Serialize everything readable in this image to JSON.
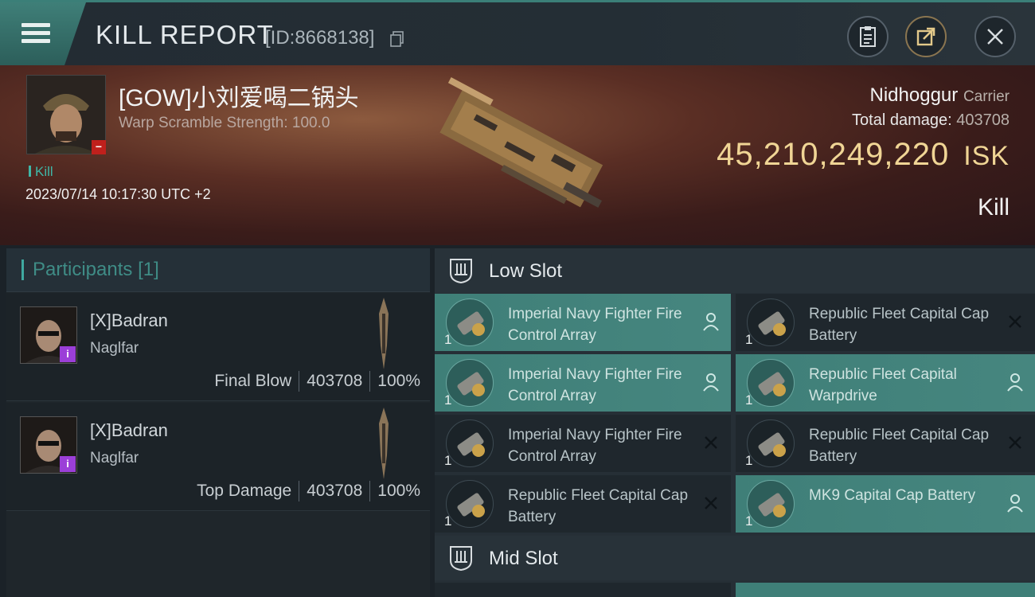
{
  "header": {
    "title": "KILL REPORT",
    "id_label": "[ID:8668138]",
    "icons": [
      "menu-icon",
      "copy-icon",
      "clipboard-icon",
      "share-icon",
      "close-icon"
    ]
  },
  "victim": {
    "pilot": "[GOW]小刘爱喝二锅头",
    "scramble": "Warp Scramble Strength: 100.0",
    "tag": "Kill",
    "datetime": "2023/07/14 10:17:30 UTC +2",
    "ship_name": "Nidhoggur",
    "ship_class": "Carrier",
    "total_damage_label": "Total damage:",
    "total_damage": "403708",
    "isk_value": "45,210,249,220",
    "isk_unit": "ISK",
    "result": "Kill"
  },
  "participants": {
    "label": "Participants",
    "count": "[1]",
    "cards": [
      {
        "name": "[X]Badran",
        "ship": "Naglfar",
        "role": "Final Blow",
        "damage": "403708",
        "percent": "100%"
      },
      {
        "name": "[X]Badran",
        "ship": "Naglfar",
        "role": "Top Damage",
        "damage": "403708",
        "percent": "100%"
      }
    ]
  },
  "slots": {
    "low_label": "Low Slot",
    "mid_label": "Mid Slot",
    "low_items": [
      {
        "qty": "1",
        "name": "Imperial Navy Fighter Fire Control Array",
        "state": "fitted",
        "mark": "person-icon"
      },
      {
        "qty": "1",
        "name": "Republic Fleet Capital Cap Battery",
        "state": "destroyed",
        "mark": "cross-icon"
      },
      {
        "qty": "1",
        "name": "Imperial Navy Fighter Fire Control Array",
        "state": "fitted",
        "mark": "person-icon"
      },
      {
        "qty": "1",
        "name": "Republic Fleet Capital Warpdrive",
        "state": "fitted",
        "mark": "person-icon"
      },
      {
        "qty": "1",
        "name": "Imperial Navy Fighter Fire Control Array",
        "state": "destroyed",
        "mark": "cross-icon"
      },
      {
        "qty": "1",
        "name": "Republic Fleet Capital Cap Battery",
        "state": "destroyed",
        "mark": "cross-icon"
      },
      {
        "qty": "1",
        "name": "Republic Fleet Capital Cap Battery",
        "state": "destroyed",
        "mark": "cross-icon"
      },
      {
        "qty": "1",
        "name": "MK9 Capital Cap Battery",
        "state": "fitted",
        "mark": "person-icon"
      }
    ]
  },
  "colors": {
    "accent": "#3f7f78",
    "isk": "#f0d595",
    "dropped": "#46867f"
  }
}
